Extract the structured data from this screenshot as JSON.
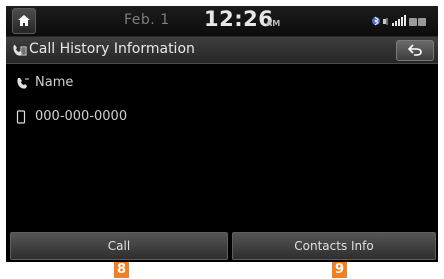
{
  "status": {
    "date": "Feb.  1",
    "time": "12:26",
    "ampm": "AM"
  },
  "header": {
    "title": "Call History Information"
  },
  "contact": {
    "name": "Name",
    "number": "000-000-0000"
  },
  "buttons": {
    "call": "Call",
    "contacts_info": "Contacts Info"
  },
  "callouts": [
    "8",
    "9"
  ],
  "icons": {
    "home": "home-icon",
    "title": "call-history-icon",
    "back": "back-icon",
    "name": "phone-icon",
    "number": "mobile-icon",
    "status": "bluetooth-signal-icon"
  },
  "colors": {
    "callout": "#f47f1f"
  }
}
